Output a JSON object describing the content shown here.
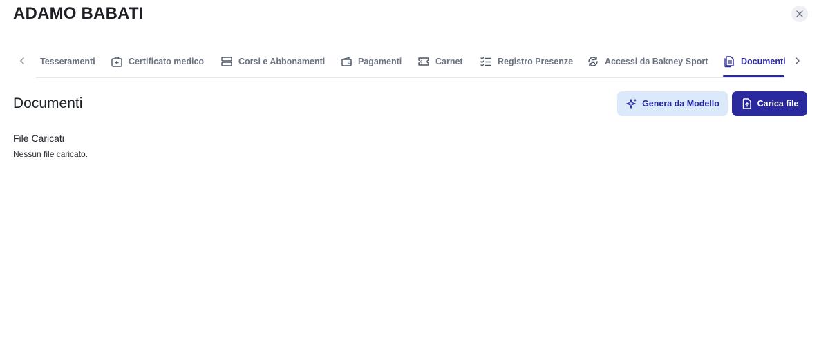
{
  "header": {
    "title": "ADAMO BABATI"
  },
  "tabs": [
    {
      "label": "Tesseramenti",
      "icon": "none"
    },
    {
      "label": "Certificato medico",
      "icon": "medical-case-icon"
    },
    {
      "label": "Corsi e Abbonamenti",
      "icon": "layers-icon"
    },
    {
      "label": "Pagamenti",
      "icon": "wallet-icon"
    },
    {
      "label": "Carnet",
      "icon": "ticket-icon"
    },
    {
      "label": "Registro Presenze",
      "icon": "checklist-icon"
    },
    {
      "label": "Accessi da Bakney Sport",
      "icon": "access-icon"
    },
    {
      "label": "Documenti",
      "icon": "document-icon",
      "active": true
    }
  ],
  "section": {
    "title": "Documenti"
  },
  "actions": {
    "generate_label": "Genera da Modello",
    "upload_label": "Carica file"
  },
  "files": {
    "heading": "File Caricati",
    "empty_message": "Nessun file caricato."
  },
  "colors": {
    "accent": "#2a2a9e",
    "accent_soft": "#dce9fb",
    "muted_text": "#6b7280"
  }
}
